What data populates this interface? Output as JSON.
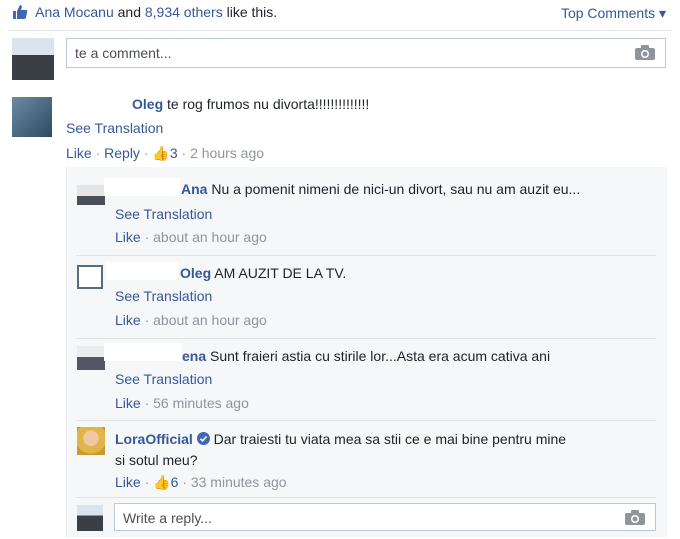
{
  "likes": {
    "first_name": "Ana Mocanu",
    "and_text": "and",
    "others": "8,934 others",
    "like_this": "like this."
  },
  "top_comments": {
    "label": "Top Comments ▾"
  },
  "comment_input": {
    "placeholder": "te a comment..."
  },
  "main_comment": {
    "author": "Oleg",
    "text": "te rog frumos nu divorta!!!!!!!!!!!!!!",
    "see_translation": "See Translation",
    "like": "Like",
    "reply": "Reply",
    "reactions": "3",
    "time": "2 hours ago"
  },
  "replies": [
    {
      "author": "Ana",
      "text": "Nu a pomenit nimeni de nici-un divort, sau nu am auzit eu...",
      "see_translation": "See Translation",
      "like": "Like",
      "time": "about an hour ago"
    },
    {
      "author": "Oleg",
      "text": "AM AUZIT DE LA TV.",
      "see_translation": "See Translation",
      "like": "Like",
      "time": "about an hour ago"
    },
    {
      "author": "ena",
      "text": "Sunt fraieri astia cu stirile lor...Asta era acum cativa ani",
      "see_translation": "See Translation",
      "like": "Like",
      "time": "56 minutes ago"
    },
    {
      "author": "LoraOfficial",
      "text_line1": "Dar traiesti tu viata mea sa stii ce e mai bine pentru mine",
      "text_line2": "si sotul meu?",
      "like": "Like",
      "reactions": "6",
      "time": "33 minutes ago"
    }
  ],
  "reply_input": {
    "placeholder": "Write a reply..."
  },
  "colors": {
    "link": "#365899",
    "meta": "#90949c",
    "verified": "#4267b2"
  }
}
